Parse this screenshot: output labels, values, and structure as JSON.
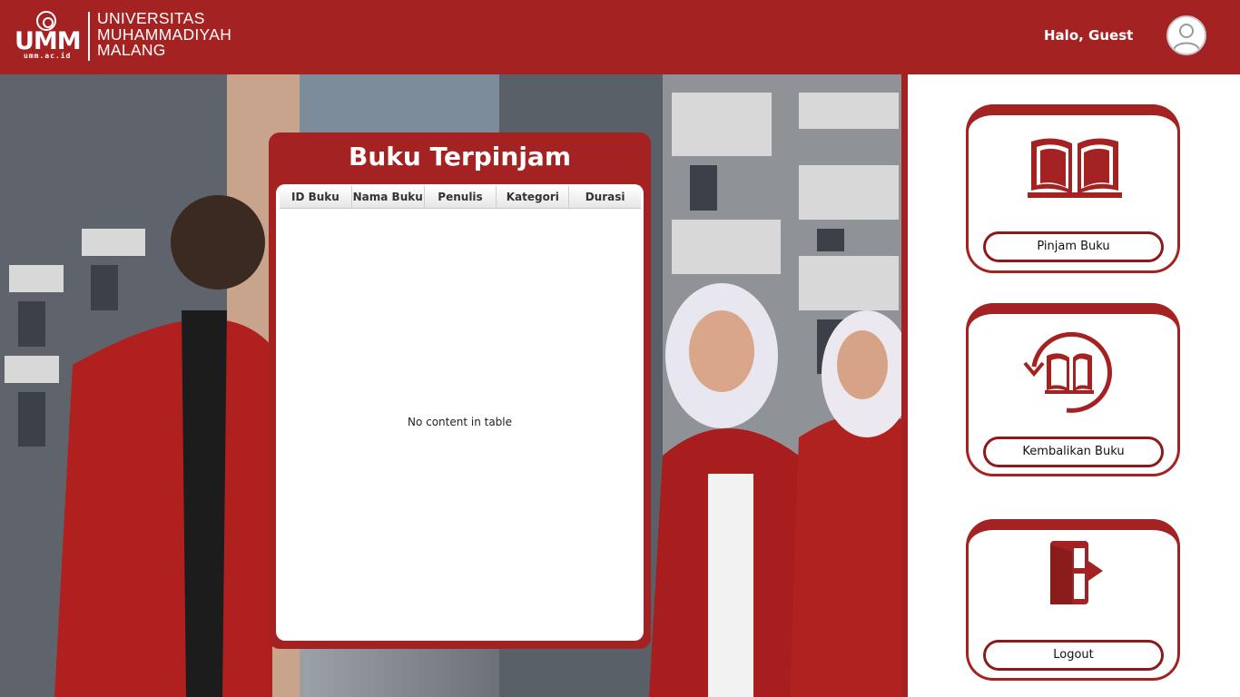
{
  "header": {
    "logo_abbr": "UMM",
    "logo_domain": "umm.ac.id",
    "logo_lines": [
      "UNIVERSITAS",
      "MUHAMMADIYAH",
      "MALANG"
    ],
    "greeting": "Halo, Guest",
    "avatar_icon": "user-avatar-icon"
  },
  "panel": {
    "title": "Buku Terpinjam",
    "columns": [
      "ID Buku",
      "Nama Buku",
      "Penulis",
      "Kategori",
      "Durasi"
    ],
    "rows": [],
    "empty_message": "No content in table"
  },
  "menu": {
    "items": [
      {
        "label": "Pinjam Buku",
        "icon": "open-book-icon"
      },
      {
        "label": "Kembalikan Buku",
        "icon": "return-book-icon"
      },
      {
        "label": "Logout",
        "icon": "logout-door-icon"
      }
    ]
  },
  "colors": {
    "brand_red": "#a52222",
    "button_border": "#8d1a1a",
    "background": "#ffffff"
  }
}
